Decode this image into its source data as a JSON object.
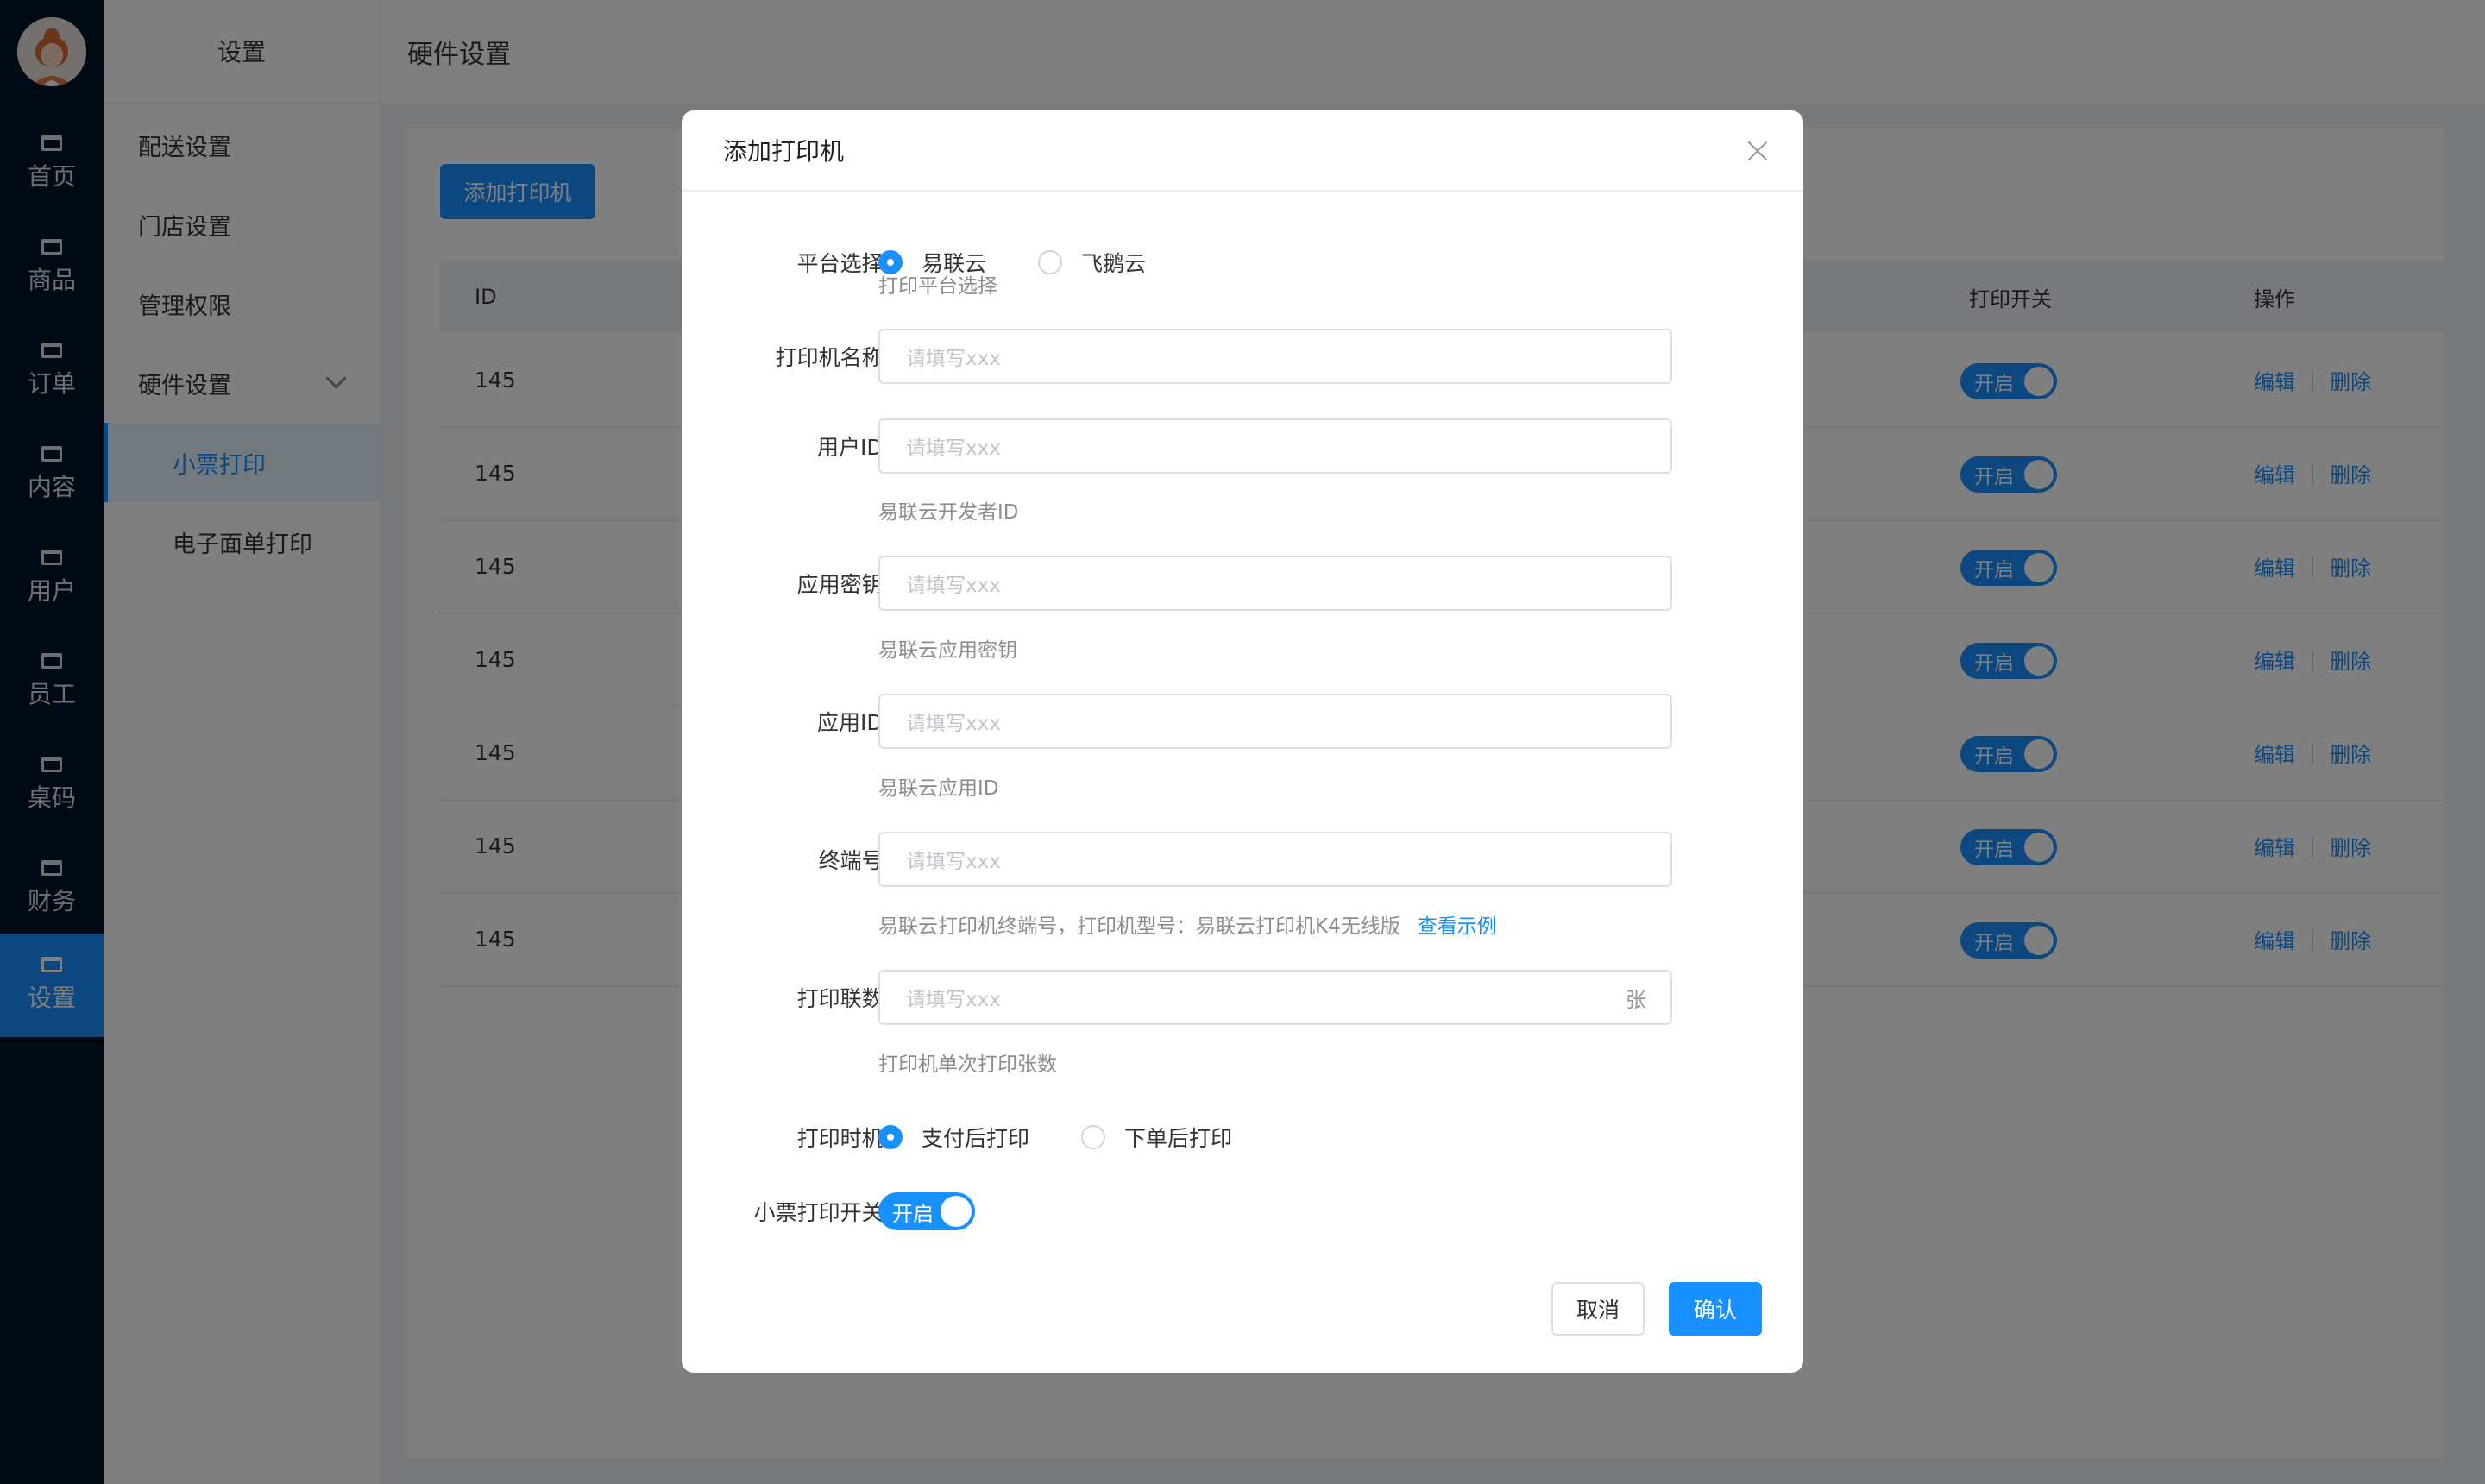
{
  "nav": {
    "items": [
      {
        "label": "首页"
      },
      {
        "label": "商品"
      },
      {
        "label": "订单"
      },
      {
        "label": "内容"
      },
      {
        "label": "用户"
      },
      {
        "label": "员工"
      },
      {
        "label": "桌码"
      },
      {
        "label": "财务"
      },
      {
        "label": "设置"
      }
    ]
  },
  "sidebar": {
    "title": "设置",
    "items": [
      {
        "label": "配送设置"
      },
      {
        "label": "门店设置"
      },
      {
        "label": "管理权限"
      },
      {
        "label": "硬件设置"
      },
      {
        "label": "小票打印"
      },
      {
        "label": "电子面单打印"
      }
    ]
  },
  "header": {
    "title": "硬件设置"
  },
  "main": {
    "add_button": "添加打印机",
    "columns": {
      "id": "ID",
      "switch": "打印开关",
      "ops": "操作"
    },
    "rows": [
      {
        "id": "145",
        "switch": "开启",
        "edit": "编辑",
        "del": "删除"
      },
      {
        "id": "145",
        "switch": "开启",
        "edit": "编辑",
        "del": "删除"
      },
      {
        "id": "145",
        "switch": "开启",
        "edit": "编辑",
        "del": "删除"
      },
      {
        "id": "145",
        "switch": "开启",
        "edit": "编辑",
        "del": "删除"
      },
      {
        "id": "145",
        "switch": "开启",
        "edit": "编辑",
        "del": "删除"
      },
      {
        "id": "145",
        "switch": "开启",
        "edit": "编辑",
        "del": "删除"
      },
      {
        "id": "145",
        "switch": "开启",
        "edit": "编辑",
        "del": "删除"
      }
    ]
  },
  "modal": {
    "title": "添加打印机",
    "platform": {
      "label": "平台选择:",
      "opt1": "易联云",
      "opt2": "飞鹅云",
      "hint": "打印平台选择"
    },
    "name": {
      "label": "打印机名称:",
      "placeholder": "请填写xxx"
    },
    "user_id": {
      "label": "用户ID:",
      "placeholder": "请填写xxx",
      "hint": "易联云开发者ID"
    },
    "app_secret": {
      "label": "应用密钥:",
      "placeholder": "请填写xxx",
      "hint": "易联云应用密钥"
    },
    "app_id": {
      "label": "应用ID:",
      "placeholder": "请填写xxx",
      "hint": "易联云应用ID"
    },
    "terminal": {
      "label": "终端号:",
      "placeholder": "请填写xxx",
      "hint": "易联云打印机终端号，打印机型号：易联云打印机K4无线版",
      "link": "查看示例"
    },
    "copies": {
      "label": "打印联数:",
      "placeholder": "请填写xxx",
      "suffix": "张",
      "hint": "打印机单次打印张数"
    },
    "timing": {
      "label": "打印时机:",
      "opt1": "支付后打印",
      "opt2": "下单后打印"
    },
    "receipt_switch": {
      "label": "小票打印开关:",
      "value": "开启"
    },
    "cancel": "取消",
    "confirm": "确认"
  },
  "colors": {
    "accent": "#1890ff",
    "nav_bg": "#001529"
  }
}
